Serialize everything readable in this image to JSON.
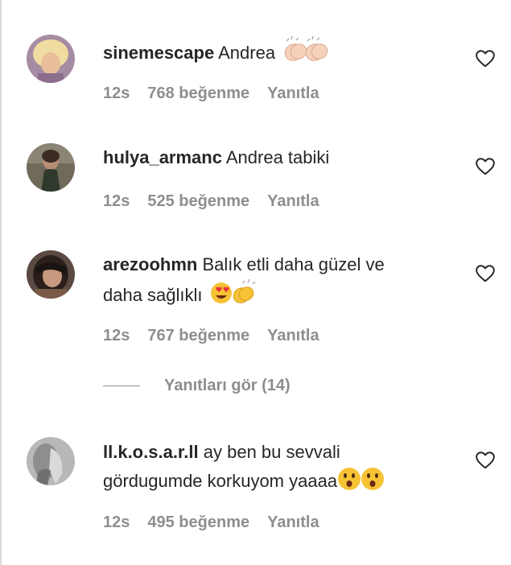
{
  "comments": [
    {
      "username": "sinemescape",
      "text": "Andrea",
      "emoji": "clapping-hands-light",
      "time": "12s",
      "likes": "768 beğenme",
      "reply": "Yanıtla"
    },
    {
      "username": "hulya_armanc",
      "text": "Andrea tabiki",
      "time": "12s",
      "likes": "525 beğenme",
      "reply": "Yanıtla"
    },
    {
      "username": "arezoohmn",
      "text_line1": "Balık etli daha güzel ve",
      "text_line2": "daha sağlıklı",
      "emoji": "heart-eyes-and-clapping",
      "time": "12s",
      "likes": "767 beğenme",
      "reply": "Yanıtla"
    },
    {
      "username": "ll.k.o.s.a.r.ll",
      "text_line1": "ay ben bu sevvali",
      "text_line2": "gördugumde korkuyom yaaaa",
      "emoji": "astonished-faces",
      "time": "12s",
      "likes": "495 beğenme",
      "reply": "Yanıtla"
    }
  ],
  "view_replies": {
    "label": "Yanıtları gör (14)"
  },
  "colors": {
    "text": "#262626",
    "secondary": "#8e8e8e",
    "emoji_yellow": "#f7c335"
  }
}
